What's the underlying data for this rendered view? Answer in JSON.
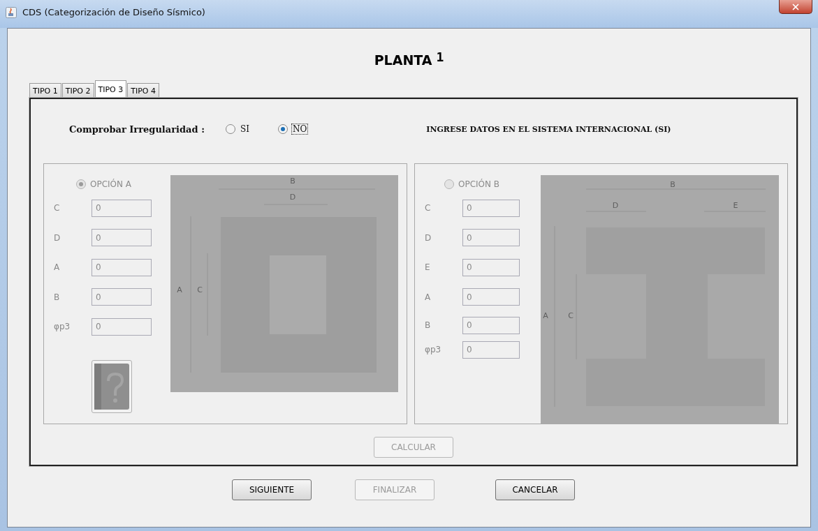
{
  "window": {
    "title": "CDS (Categorización de Diseño Sísmico)"
  },
  "heading": {
    "label": "PLANTA",
    "number": "1"
  },
  "tabs": [
    {
      "label": "TIPO 1",
      "selected": false
    },
    {
      "label": "TIPO 2",
      "selected": false
    },
    {
      "label": "TIPO 3",
      "selected": true
    },
    {
      "label": "TIPO 4",
      "selected": false
    }
  ],
  "irregularity": {
    "label": "Comprobar Irregularidad :",
    "options": [
      {
        "label": "SI",
        "selected": false,
        "focused": false
      },
      {
        "label": "NO",
        "selected": true,
        "focused": true
      }
    ]
  },
  "notice": "INGRESE DATOS EN EL SISTEMA INTERNACIONAL (SI)",
  "options": [
    {
      "label": "OPCIÓN A",
      "selected": true,
      "disabled": true,
      "help_button": true,
      "fields": [
        {
          "label": "C",
          "value": "0"
        },
        {
          "label": "D",
          "value": "0"
        },
        {
          "label": "A",
          "value": "0"
        },
        {
          "label": "B",
          "value": "0"
        },
        {
          "label": "φp3",
          "value": "0"
        }
      ],
      "diagram": {
        "kind": "square",
        "labels": [
          "B",
          "D",
          "A",
          "C"
        ]
      }
    },
    {
      "label": "OPCIÓN B",
      "selected": false,
      "disabled": true,
      "help_button": false,
      "fields": [
        {
          "label": "C",
          "value": "0"
        },
        {
          "label": "D",
          "value": "0"
        },
        {
          "label": "E",
          "value": "0"
        },
        {
          "label": "A",
          "value": "0"
        },
        {
          "label": "B",
          "value": "0"
        },
        {
          "label": "φp3",
          "value": "0"
        }
      ],
      "diagram": {
        "kind": "i-shape",
        "labels": [
          "B",
          "D",
          "E",
          "A",
          "C"
        ]
      }
    }
  ],
  "calculate_button": {
    "label": "CALCULAR",
    "disabled": true
  },
  "buttons": [
    {
      "label": "SIGUIENTE",
      "disabled": false
    },
    {
      "label": "FINALIZAR",
      "disabled": true
    },
    {
      "label": "CANCELAR",
      "disabled": false
    }
  ]
}
